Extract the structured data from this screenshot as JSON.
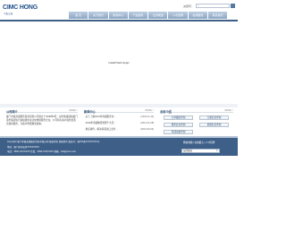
{
  "header": {
    "logo_text": "CIMC HONG",
    "logo_subtitle": "中集宏图",
    "search_label": "关键字：",
    "nav": [
      "首 页",
      "关于我们",
      "新闻中心",
      "产品服务",
      "业务概述",
      "人才招聘",
      "在线服务",
      "联系我们"
    ]
  },
  "hero": {
    "message": "Install Flash plugin"
  },
  "about": {
    "title": "公司简介",
    "more": "MORE >",
    "text": "厦门中集海铺服务贸易有限公司成立于2008年6月，是中集集团和厦门港务集团等合资组建的专业化物流服务企业，公司将为客户提供优质高效的服务，为客户降低物流成本。"
  },
  "news": {
    "title": "新闻中心",
    "more": "MORE >",
    "items": [
      {
        "title": "· 关于了解2013年海铺服务市...",
        "date": "[2013-11-11]"
      },
      {
        "title": "· 2013年海铺物流管理十大活...",
        "date": "[2013-11-08]"
      },
      {
        "title": "· 重庆事件，解决海铺出口业务...",
        "date": "[2013-09-04]"
      }
    ]
  },
  "services": {
    "title": "业务介绍",
    "more": "MORE >",
    "buttons": [
      "订单跟踪查询",
      "订舱信息查询",
      "箱务信息查询",
      "船期信息查询",
      "海铺动态查询"
    ]
  },
  "footer": {
    "line1": "Copyright 厦门中集海铺服务贸易有限公司 版权所有 保留所有 备案号：闽ICP备XXXXXXXX号",
    "line2": "地址：厦门市同安区XXXXXXXX",
    "line3": "电话：0592-XXXXXXX  传真：0592-XXXXXXX  邮箱：info@xxxx.com",
    "links": "网站地图  |  在线留言  |  人才招聘",
    "select_label": "友情链接"
  }
}
